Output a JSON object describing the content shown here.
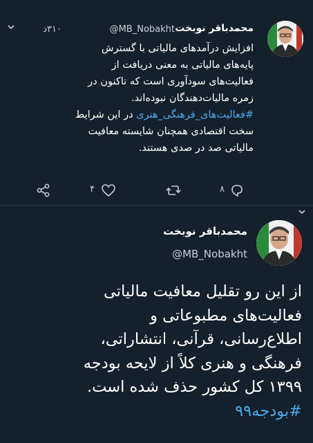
{
  "tweet1": {
    "name": "محمدباقر نوبخت",
    "handle": "@MB_Nobakht",
    "time": "۳۱۰د",
    "body_part1": "افزایش درآمدهای مالیاتی با گسترش\nپایه‌های مالیاتی به معنی دریافت از\nفعالیت‌های سودآوری است که تاکنون در\nزمره مالیات‌دهندگان نبوده‌اند.\n",
    "hashtag": "#فعالیت‌های_فرهنگی_هنری",
    "body_part2": " در این شرایط\nسخت اقتصادی همچنان شایسته معافیت\nمالیاتی صد در صدی هستند.",
    "reply_count": "۸",
    "like_count": "۴"
  },
  "tweet2": {
    "name": "محمدباقر نوبخت",
    "handle": "@MB_Nobakht",
    "body": "از این رو تقلیل معافیت مالیاتی\nفعالیت‌های مطبوعاتی و\nاطلاع‌رسانی، قرآنی، انتشاراتی،\nفرهنگی و هنری کلاً از لایحه بودجه\n۱۳۹۹ کل کشور حذف شده است.\n",
    "hashtag": "#بودجه۹۹"
  },
  "colors": {
    "background": "#14202b",
    "link": "#4aa8ec",
    "muted": "#c8d0d8"
  }
}
